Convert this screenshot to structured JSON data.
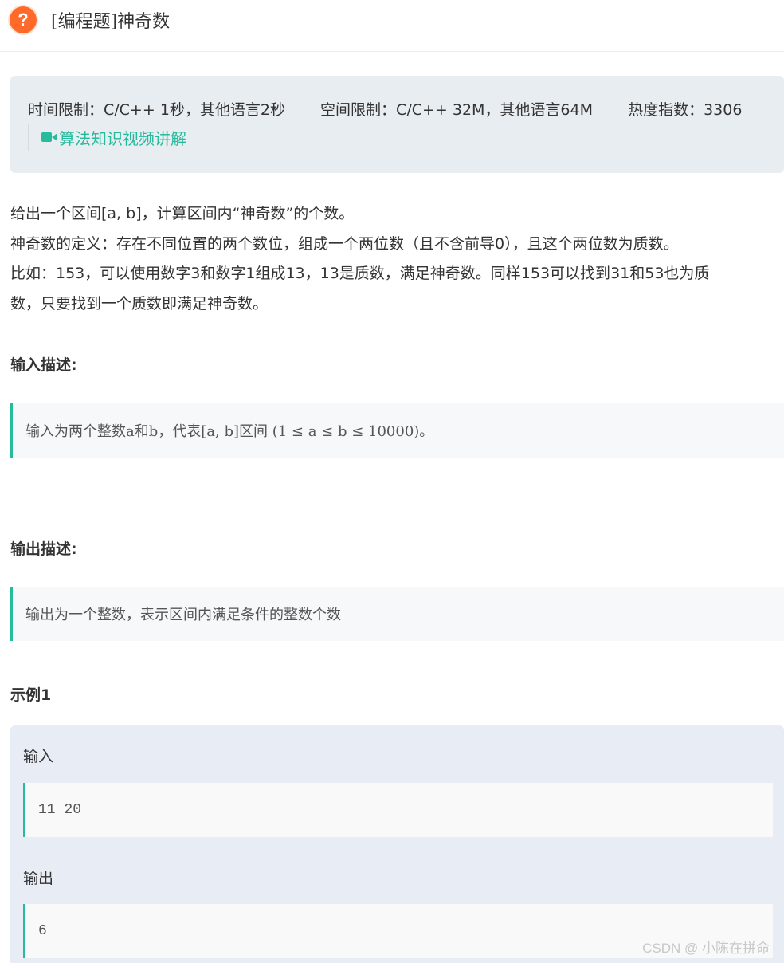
{
  "header": {
    "icon": "question-icon",
    "icon_glyph": "?",
    "title": "[编程题]神奇数"
  },
  "info": {
    "time_limit": "时间限制：C/C++ 1秒，其他语言2秒",
    "space_limit": "空间限制：C/C++ 32M，其他语言64M",
    "heat_index": "热度指数：3306",
    "video_link": "算法知识视频讲解",
    "accent_color": "#25bb9b"
  },
  "description": [
    "给出一个区间[a, b]，计算区间内“神奇数”的个数。",
    "神奇数的定义：存在不同位置的两个数位，组成一个两位数（且不含前导0），且这个两位数为质数。",
    "比如：153，可以使用数字3和数字1组成13，13是质数，满足神奇数。同样153可以找到31和53也为质",
    "数，只要找到一个质数即满足神奇数。"
  ],
  "input_section": {
    "title": "输入描述:",
    "content": "输入为两个整数a和b，代表[a, b]区间 (1 ≤ a ≤ b ≤ 10000)。"
  },
  "output_section": {
    "title": "输出描述:",
    "content": "输出为一个整数，表示区间内满足条件的整数个数"
  },
  "example": {
    "title": "示例1",
    "input_label": "输入",
    "input_value": "11 20",
    "output_label": "输出",
    "output_value": "6"
  },
  "watermark": "CSDN @  小陈在拼命"
}
